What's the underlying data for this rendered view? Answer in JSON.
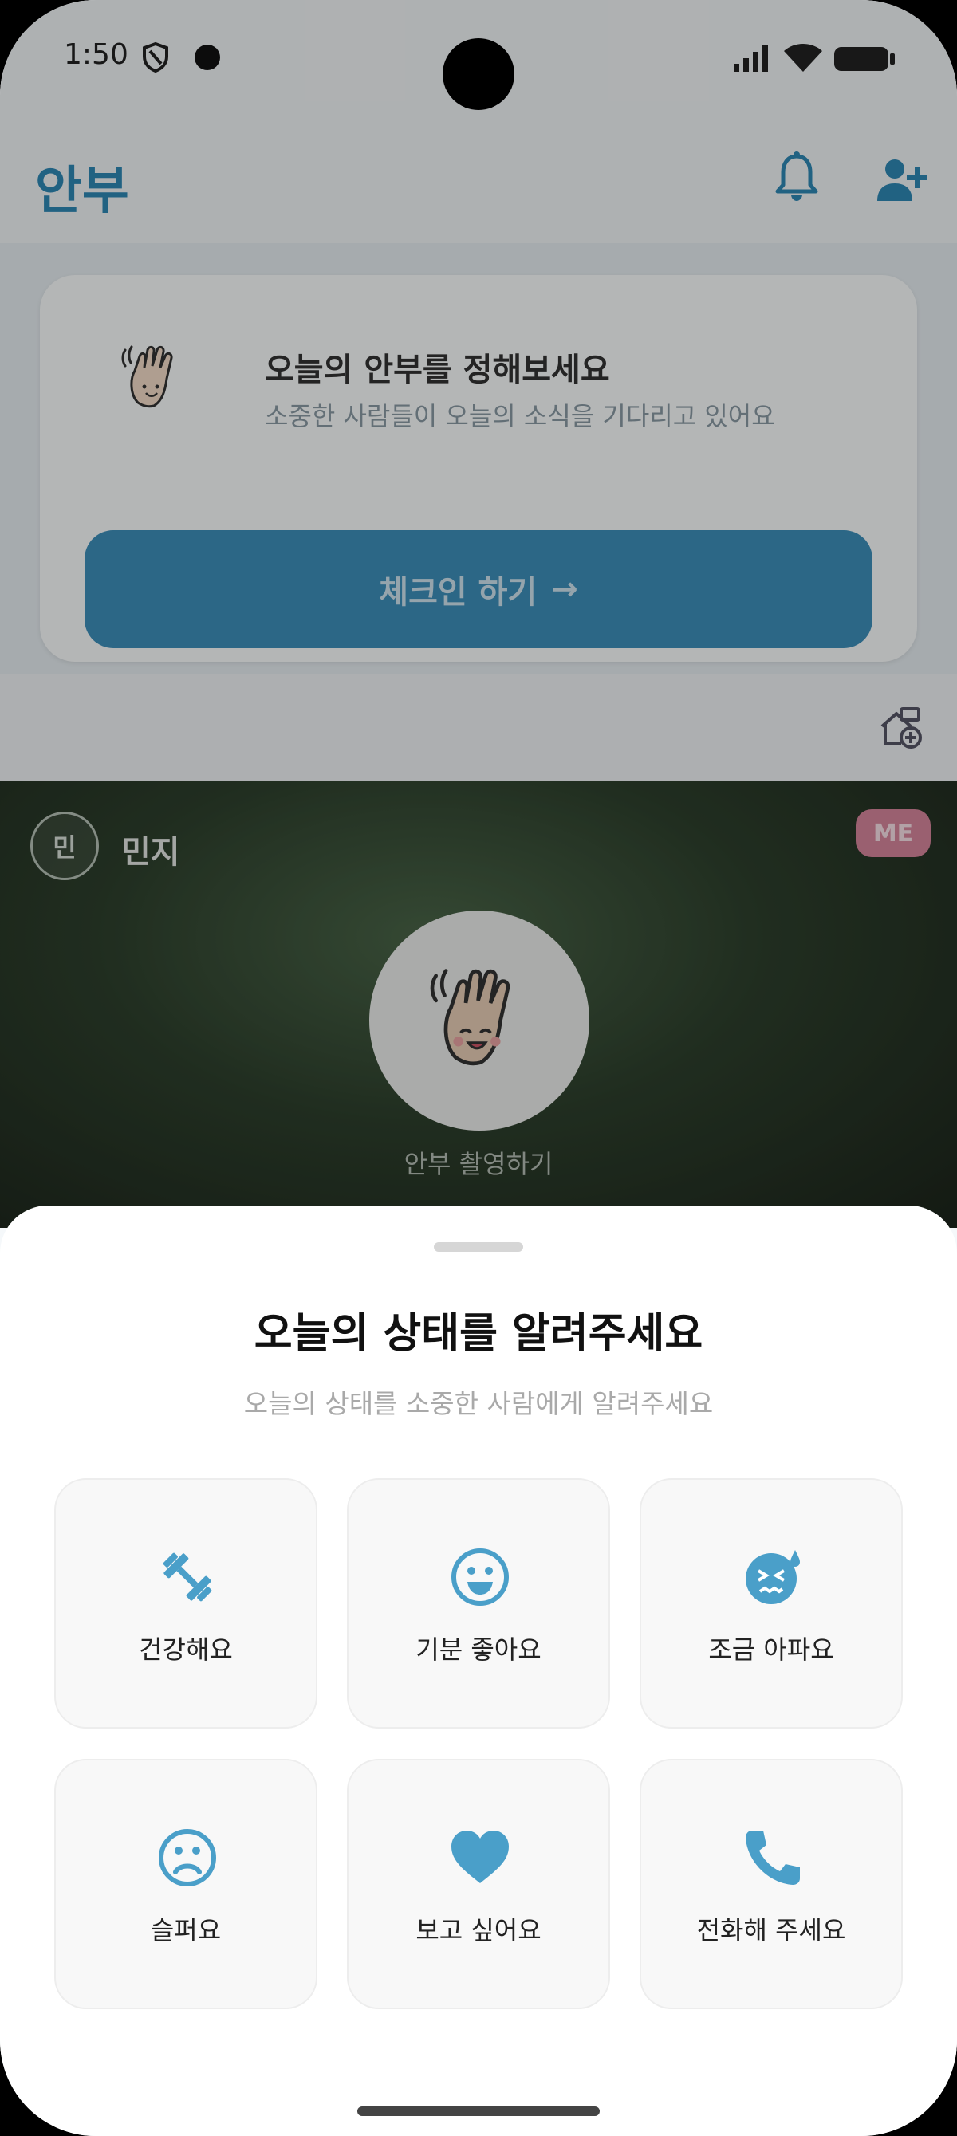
{
  "status_bar": {
    "time": "1:50"
  },
  "header": {
    "title": "안부"
  },
  "checkin_card": {
    "heading": "오늘의 안부를 정해보세요",
    "subtitle": "소중한 사람들이 오늘의 소식을 기다리고 있어요",
    "button_label": "체크인 하기",
    "button_arrow": "→"
  },
  "member": {
    "avatar_initial": "민",
    "name": "민지",
    "badge": "ME",
    "capture_label": "안부 촬영하기"
  },
  "sheet": {
    "title": "오늘의 상태를 알려주세요",
    "subtitle": "오늘의 상태를 소중한 사람에게 알려주세요",
    "options": [
      {
        "label": "건강해요",
        "icon": "dumbbell-icon"
      },
      {
        "label": "기분 좋아요",
        "icon": "smile-icon"
      },
      {
        "label": "조금 아파요",
        "icon": "sick-face-icon"
      },
      {
        "label": "슬퍼요",
        "icon": "sad-face-icon"
      },
      {
        "label": "보고 싶어요",
        "icon": "heart-icon"
      },
      {
        "label": "전화해 주세요",
        "icon": "phone-icon"
      }
    ]
  },
  "colors": {
    "accent": "#4a9fc9",
    "brand_blue": "#2f88b5",
    "me_badge": "#d6859b"
  }
}
